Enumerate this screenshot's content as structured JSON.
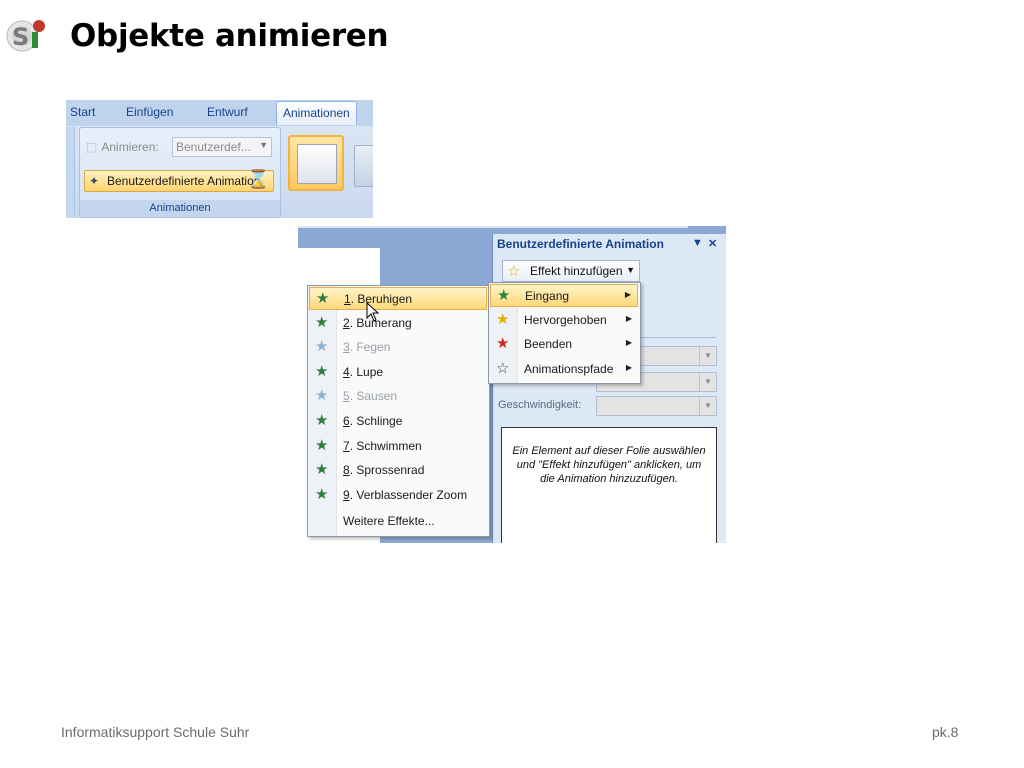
{
  "slide": {
    "title": "Objekte animieren",
    "footer_left": "Informatiksupport Schule Suhr",
    "footer_right": "pk.8",
    "logo_text": "Si"
  },
  "ribbon": {
    "tabs": [
      "Start",
      "Einfügen",
      "Entwurf",
      "Animationen"
    ],
    "active_tab": "Animationen",
    "animieren_label": "Animieren:",
    "animieren_value": "Benutzerdef...",
    "custom_button_label": "Benutzerdefinierte Animation",
    "group_label": "Animationen"
  },
  "task_pane": {
    "title": "Benutzerdefinierte Animation",
    "add_effect_label": "Effekt hinzufügen",
    "speed_label": "Geschwindigkeit:",
    "hint_text": "Ein Element auf dieser Folie auswählen und \"Effekt hinzufügen\" anklicken, um die Animation hinzuzufügen."
  },
  "effect_menu": {
    "items": [
      {
        "num": "1",
        "label": ". Beruhigen",
        "enabled": true,
        "highlighted": true
      },
      {
        "num": "2",
        "label": ". Bumerang",
        "enabled": true,
        "highlighted": false
      },
      {
        "num": "3",
        "label": ". Fegen",
        "enabled": false,
        "highlighted": false
      },
      {
        "num": "4",
        "label": ". Lupe",
        "enabled": true,
        "highlighted": false
      },
      {
        "num": "5",
        "label": ". Sausen",
        "enabled": false,
        "highlighted": false
      },
      {
        "num": "6",
        "label": ". Schlinge",
        "enabled": true,
        "highlighted": false
      },
      {
        "num": "7",
        "label": ". Schwimmen",
        "enabled": true,
        "highlighted": false
      },
      {
        "num": "8",
        "label": ". Sprossenrad",
        "enabled": true,
        "highlighted": false
      },
      {
        "num": "9",
        "label": ". Verblassender Zoom",
        "enabled": true,
        "highlighted": false
      }
    ],
    "more_effects": "Weitere Effekte..."
  },
  "category_menu": {
    "items": [
      {
        "label": "Eingang",
        "icon": "green-star-icon",
        "color": "#1f8a3a",
        "highlighted": true
      },
      {
        "label": "Hervorgehoben",
        "icon": "yellow-star-icon",
        "color": "#e0b000",
        "highlighted": false
      },
      {
        "label": "Beenden",
        "icon": "red-star-icon",
        "color": "#d22a1a",
        "highlighted": false
      },
      {
        "label": "Animationspfade",
        "icon": "outline-star-icon",
        "color": "#444444",
        "highlighted": false
      }
    ]
  }
}
